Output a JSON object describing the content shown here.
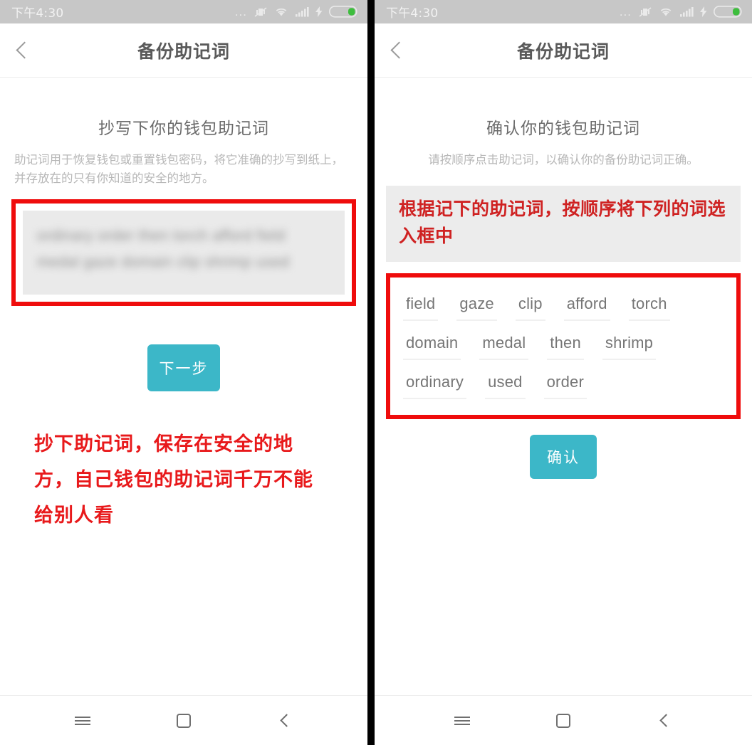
{
  "status_bar": {
    "time": "下午4:30",
    "dots": "...",
    "icons": [
      "more-dots-icon",
      "vibrate-mute-icon",
      "wifi-icon",
      "signal-bars-icon",
      "charging-bolt-icon",
      "battery-icon"
    ]
  },
  "nav_bar": {
    "menu_label": "menu",
    "home_label": "home",
    "back_label": "back"
  },
  "colors": {
    "accent_teal": "#3cb7c8",
    "annotation_red": "#ef0c0c",
    "note_red_text": "#cf2222",
    "status_bar_grey": "#c7c7c7",
    "field_grey": "#eaeaea",
    "banner_grey": "#ececec"
  },
  "left_screen": {
    "title": "备份助记词",
    "heading": "抄写下你的钱包助记词",
    "subtitle": "助记词用于恢复钱包或重置钱包密码，将它准确的抄写到纸上，并存放在的只有你知道的安全的地方。",
    "mnemonic_blurred": "ordinary order then torch afford field medal gaze domain clip shrimp used",
    "next_button": "下一步",
    "red_annotation": "抄下助记词，保存在安全的地方，自己钱包的助记词千万不能给别人看"
  },
  "right_screen": {
    "title": "备份助记词",
    "heading": "确认你的钱包助记词",
    "subtitle": "请按顺序点击助记词，以确认你的备份助记词正确。",
    "red_banner": "根据记下的助记词，按顺序将下列的词选入框中",
    "word_rows": [
      [
        "field",
        "gaze",
        "clip",
        "afford",
        "torch"
      ],
      [
        "domain",
        "medal",
        "then",
        "shrimp"
      ],
      [
        "ordinary",
        "used",
        "order"
      ]
    ],
    "confirm_button": "确认"
  }
}
